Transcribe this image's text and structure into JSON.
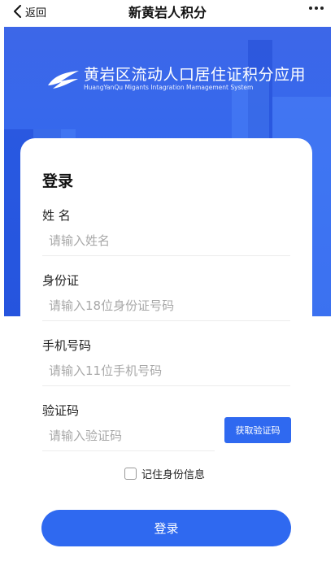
{
  "nav": {
    "back_label": "返回",
    "title": "新黄岩人积分"
  },
  "banner": {
    "app_name": "黄岩区流动人口居住证积分应用",
    "app_name_en": "HuangYanQu Migants Intagration Mamagement System",
    "logo_icon": "wing-logo-icon"
  },
  "form": {
    "heading": "登录",
    "fields": [
      {
        "label": "姓 名",
        "placeholder": "请输入姓名",
        "value": ""
      },
      {
        "label": "身份证",
        "placeholder": "请输入18位身份证号码",
        "value": ""
      },
      {
        "label": "手机号码",
        "placeholder": "请输入11位手机号码",
        "value": ""
      },
      {
        "label": "验证码",
        "placeholder": "请输入验证码",
        "value": ""
      }
    ],
    "get_code_label": "获取验证码",
    "remember_label": "记住身份信息",
    "remember_checked": false,
    "submit_label": "登录"
  },
  "colors": {
    "primary": "#2f69f0",
    "banner": "#3468ee"
  }
}
